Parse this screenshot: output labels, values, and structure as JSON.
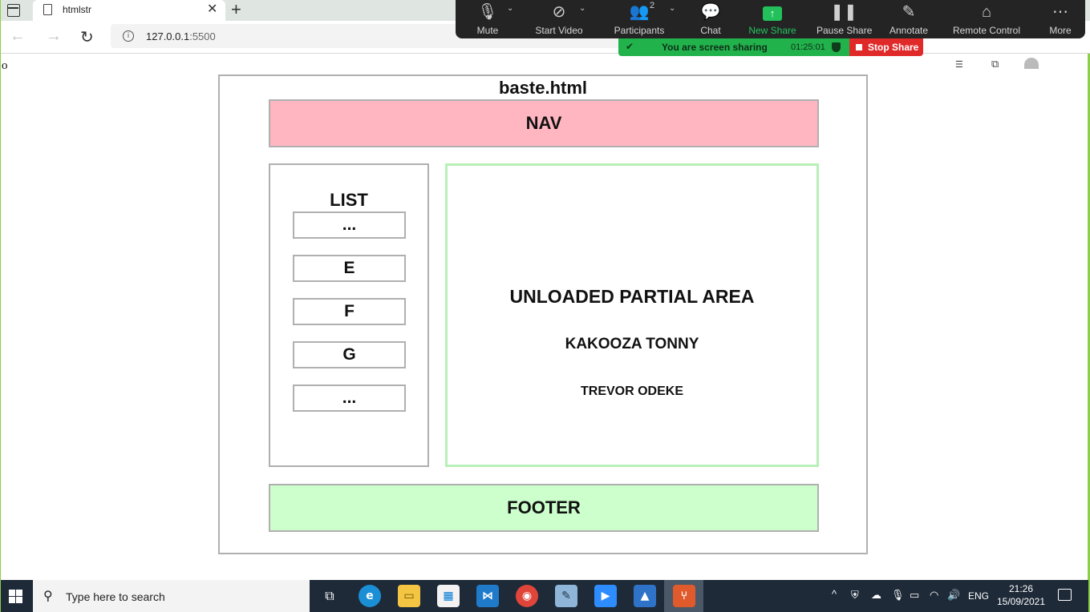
{
  "browser": {
    "tab_title": "htmlstr",
    "url_host": "127.0.0.1",
    "url_port": ":5500"
  },
  "zoom": {
    "buttons": [
      {
        "label": "Mute"
      },
      {
        "label": "Start Video"
      },
      {
        "label": "Participants",
        "count": "2"
      },
      {
        "label": "Chat"
      },
      {
        "label": "New Share"
      },
      {
        "label": "Pause Share"
      },
      {
        "label": "Annotate"
      },
      {
        "label": "Remote Control"
      },
      {
        "label": "More"
      }
    ],
    "sharing_text": "You are screen sharing",
    "sharing_timer": "01:25:01",
    "stop_share": "Stop Share",
    "accent": "#22b24c",
    "stop_color": "#e02a2a"
  },
  "page": {
    "stray_char": "o",
    "title": "baste.html",
    "nav": "NAV",
    "list_title": "LIST",
    "list_items": [
      "...",
      "E",
      "F",
      "G",
      "..."
    ],
    "partial_title": "UNLOADED PARTIAL AREA",
    "partial_name1": "KAKOOZA TONNY",
    "partial_name2": "TREVOR ODEKE",
    "footer": "FOOTER",
    "nav_color": "#ffb6c1",
    "footer_color": "#ccffcc",
    "partial_border_color": "#b8f0b8"
  },
  "taskbar": {
    "search_placeholder": "Type here to search",
    "language": "ENG",
    "time": "21:26",
    "date": "15/09/2021",
    "apps": [
      "task-view",
      "edge",
      "file-explorer",
      "store",
      "vscode",
      "chrome",
      "notepad",
      "zoom",
      "photos",
      "git"
    ]
  }
}
